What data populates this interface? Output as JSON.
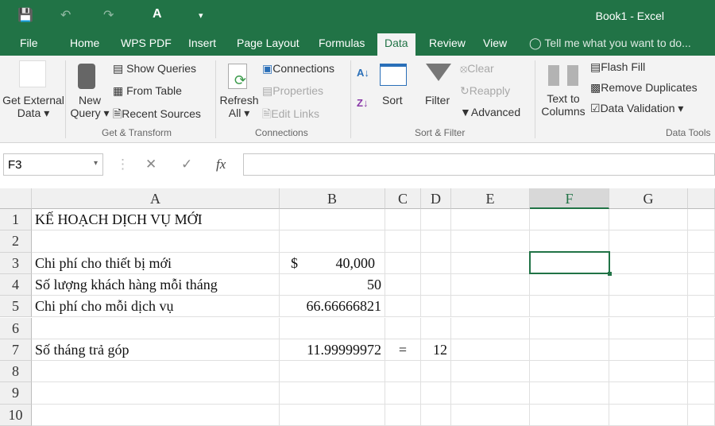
{
  "window": {
    "title": "Book1 - Excel",
    "qa_font": "A"
  },
  "tabs": [
    "File",
    "Home",
    "WPS PDF",
    "Insert",
    "Page Layout",
    "Formulas",
    "Data",
    "Review",
    "View"
  ],
  "tell_me": "Tell me what you want to do...",
  "ribbon": {
    "get_external": [
      "Get External",
      "Data ▾"
    ],
    "new_query": [
      "New",
      "Query ▾"
    ],
    "show_queries": "Show Queries",
    "from_table": "From Table",
    "recent_sources": "Recent Sources",
    "group_get_transform": "Get & Transform",
    "refresh_all": [
      "Refresh",
      "All ▾"
    ],
    "connections": "Connections",
    "properties": "Properties",
    "edit_links": "Edit Links",
    "group_connections": "Connections",
    "sort": "Sort",
    "filter": "Filter",
    "clear": "Clear",
    "reapply": "Reapply",
    "advanced": "Advanced",
    "group_sort_filter": "Sort & Filter",
    "text_to_columns": [
      "Text to",
      "Columns"
    ],
    "flash_fill": "Flash Fill",
    "remove_duplicates": "Remove Duplicates",
    "data_validation": "Data Validation  ▾",
    "group_data_tools": "Data Tools"
  },
  "formula_bar": {
    "name_box": "F3",
    "cancel": "✕",
    "enter": "✓",
    "fx": "fx",
    "value": ""
  },
  "columns": [
    "A",
    "B",
    "C",
    "D",
    "E",
    "F",
    "G"
  ],
  "rows": [
    "1",
    "2",
    "3",
    "4",
    "5",
    "6",
    "7",
    "8",
    "9",
    "10"
  ],
  "cells": {
    "A1": "KẾ HOẠCH DỊCH VỤ MỚI",
    "A3": "Chi phí cho thiết bị mới",
    "B3_sym": "$",
    "B3": "40,000",
    "A4": "Số lượng khách hàng mỗi tháng",
    "B4": "50",
    "A5": "Chi phí cho mỗi dịch vụ",
    "B5": "66.66666821",
    "A7": "Số tháng trả góp",
    "B7": "11.99999972",
    "C7": "=",
    "D7": "12"
  },
  "selected_cell": "F3"
}
